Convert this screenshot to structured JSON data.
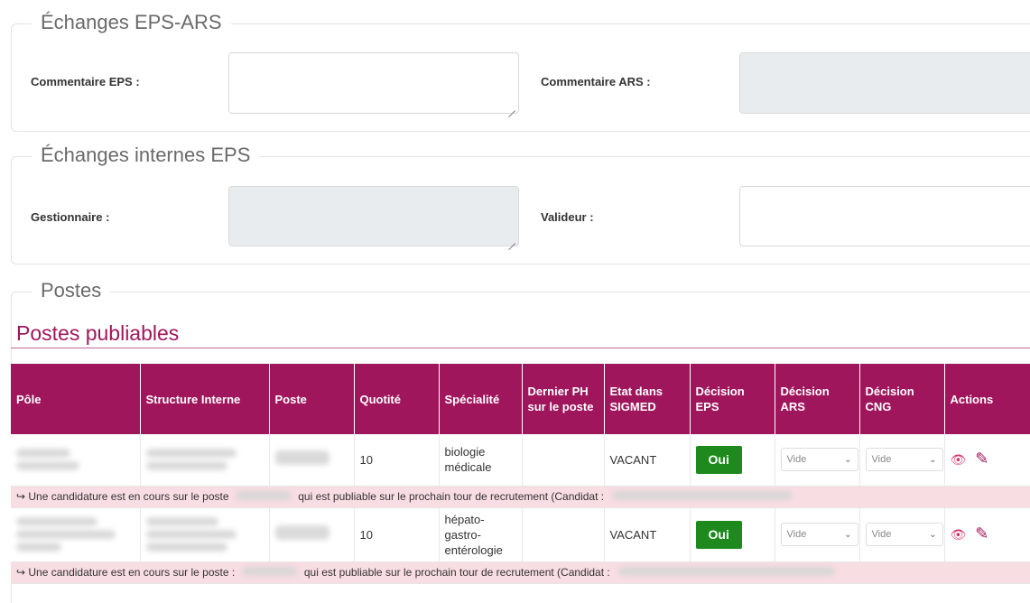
{
  "echanges_eps_ars": {
    "legend": "Échanges EPS-ARS",
    "commentaire_eps_label": "Commentaire EPS :",
    "commentaire_ars_label": "Commentaire ARS :"
  },
  "echanges_internes": {
    "legend": "Échanges internes EPS",
    "gestionnaire_label": "Gestionnaire :",
    "valideur_label": "Valideur :"
  },
  "postes": {
    "legend": "Postes",
    "publiables_title": "Postes publiables",
    "columns": [
      "Pôle",
      "Structure Interne",
      "Poste",
      "Quotité",
      "Spécialité",
      "Dernier PH sur le poste",
      "Etat dans SIGMED",
      "Décision EPS",
      "Décision ARS",
      "Décision CNG",
      "Actions"
    ],
    "rows": [
      {
        "quotite": "10",
        "specialite": "biologie médicale",
        "etat": "VACANT",
        "decision_eps": "Oui",
        "decision_ars": "Vide",
        "decision_cng": "Vide",
        "info_prefix": "↪ Une candidature est en cours sur le poste",
        "info_suffix": "qui est publiable sur le prochain tour de recrutement (Candidat :"
      },
      {
        "quotite": "10",
        "specialite": "hépato-gastro-entérologie",
        "etat": "VACANT",
        "decision_eps": "Oui",
        "decision_ars": "Vide",
        "decision_cng": "Vide",
        "info_prefix": "↪ Une candidature est en cours sur le poste :",
        "info_suffix": "qui est publiable sur le prochain tour de recrutement (Candidat :"
      }
    ]
  },
  "icons": {
    "view": "eye-icon",
    "edit": "edit-icon"
  },
  "colors": {
    "brand": "#a0165c",
    "oui": "#1e8a1e",
    "info_bg": "#f8dde3"
  }
}
